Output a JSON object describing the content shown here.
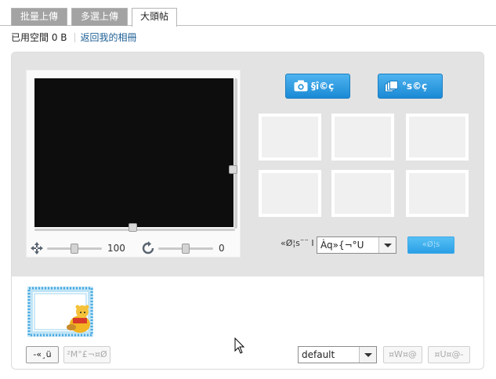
{
  "tabs": [
    {
      "label": "批量上傳",
      "active": false
    },
    {
      "label": "多選上傳",
      "active": false
    },
    {
      "label": "大頭帖",
      "active": true
    }
  ],
  "info": {
    "used_space": "已用空間 0 B",
    "back_link": "返回我的相冊"
  },
  "editor": {
    "zoom_value": "100",
    "rotate_value": "0",
    "zoom_level": 0.5,
    "rotate_level": 0.5
  },
  "capture": {
    "camera_label": "§î©ç",
    "multi_label": "°s©ç",
    "camera_icon": "camera-icon",
    "multi_icon": "copy-icon"
  },
  "frame": {
    "label": "«Ø¦s¨¨ I",
    "select_value": "Àq»{¬°U",
    "apply_label": "«Ø¦s"
  },
  "bottom": {
    "left_button": "-«¸ü",
    "left_button_dim": "²M°£¬¤Ø",
    "preset_select": "default",
    "right_button_1": "¤W¤@",
    "right_button_2": "¤U¤@-"
  },
  "colors": {
    "accent": "#1a8ad5",
    "tab_inactive": "#a3a3a3",
    "panel_bg": "#e3e3e3",
    "canvas": "#0d0d0d",
    "link": "#1b5e94"
  }
}
